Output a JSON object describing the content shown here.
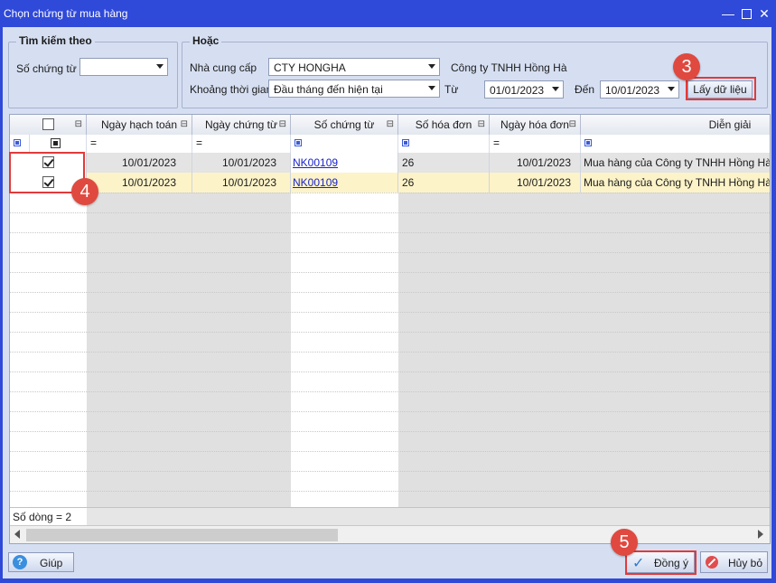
{
  "window": {
    "title": "Chọn chứng từ mua hàng"
  },
  "search": {
    "legend": "Tìm kiếm theo",
    "doc_no_label": "Số chứng từ",
    "doc_no_value": ""
  },
  "or_group": {
    "legend": "Hoặc",
    "supplier_label": "Nhà cung cấp",
    "supplier_value": "CTY HONGHA",
    "supplier_name": "Công ty TNHH Hồng Hà",
    "period_label": "Khoảng thời gian",
    "period_value": "Đầu tháng đến hiện tại",
    "from_label": "Từ",
    "from_value": "01/01/2023",
    "to_label": "Đến",
    "to_value": "10/01/2023",
    "load_button": "Lấy dữ liệu"
  },
  "grid": {
    "columns": [
      "Ngày hạch toán",
      "Ngày chứng từ",
      "Số chứng từ",
      "Số hóa đơn",
      "Ngày hóa đơn",
      "Diễn giải"
    ],
    "rows": [
      {
        "checked": true,
        "posting_date": "10/01/2023",
        "doc_date": "10/01/2023",
        "doc_no": "NK00109",
        "invoice_no": "26",
        "invoice_date": "10/01/2023",
        "description": "Mua hàng của Công ty TNHH Hồng Hà the"
      },
      {
        "checked": true,
        "posting_date": "10/01/2023",
        "doc_date": "10/01/2023",
        "doc_no": "NK00109",
        "invoice_no": "26",
        "invoice_date": "10/01/2023",
        "description": "Mua hàng của Công ty TNHH Hồng Hà the"
      }
    ],
    "row_count": "Số dòng = 2"
  },
  "footer": {
    "help": "Giúp",
    "ok": "Đồng ý",
    "cancel": "Hủy bỏ"
  },
  "badges": {
    "b3": "3",
    "b4": "4",
    "b5": "5"
  },
  "colors": {
    "title_bar": "#2f49d9",
    "client_bg": "#d6dff2",
    "highlight": "#e23a3a",
    "badge": "#e0493f",
    "selected_row": "#fdf3c8",
    "link": "#1a23c9"
  }
}
